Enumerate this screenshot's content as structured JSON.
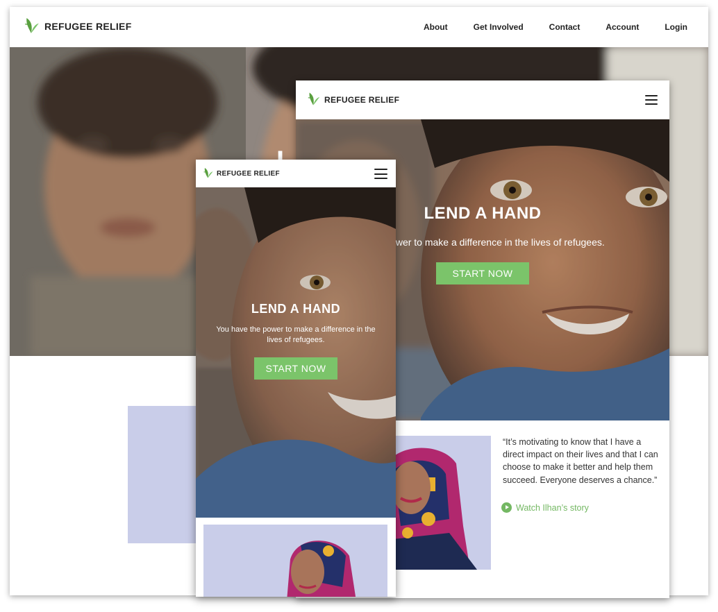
{
  "brand": {
    "name": "REFUGEE RELIEF",
    "logo_icon": "hummingbird-leaf-icon",
    "accent": "#7bc46a"
  },
  "desktop": {
    "nav": [
      "About",
      "Get Involved",
      "Contact",
      "Account",
      "Login"
    ],
    "hero_title_partial": "L"
  },
  "tablet": {
    "hero": {
      "title": "LEND A HAND",
      "subtitle": "e the power to make a difference in the lives of refugees.",
      "cta": "START NOW"
    },
    "testimonial": {
      "quote": "“It’s motivating to know that I have a direct impact on their lives and that I can choose to make it better and help them succeed. Everyone deserves a chance.”",
      "link": "Watch Ilhan’s story"
    },
    "menu_icon": "hamburger-icon"
  },
  "phone": {
    "hero": {
      "title": "LEND A HAND",
      "subtitle": "You have the power to make a difference in the lives of refugees.",
      "cta": "START NOW"
    },
    "menu_icon": "hamburger-icon"
  },
  "colors": {
    "cta_green": "#7bc46a",
    "portrait_bg": "#c9cde9",
    "link_green": "#74b863"
  }
}
